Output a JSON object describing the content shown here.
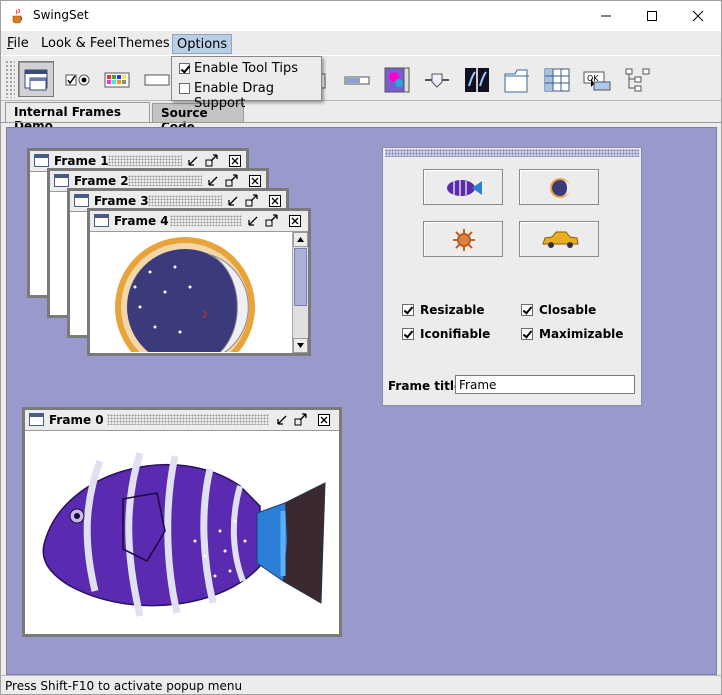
{
  "window": {
    "title": "SwingSet"
  },
  "menubar": {
    "items": [
      {
        "label": "File",
        "mnemonic": "F"
      },
      {
        "label": "Look & Feel",
        "mnemonic": "L"
      },
      {
        "label": "Themes",
        "mnemonic": "T"
      },
      {
        "label": "Options",
        "mnemonic": "O",
        "active": true
      }
    ]
  },
  "options_menu": {
    "items": [
      {
        "label": "Enable Tool Tips",
        "checked": true
      },
      {
        "label": "Enable Drag Support",
        "checked": false
      }
    ]
  },
  "toolbar": {
    "buttons": [
      {
        "icon": "internal-frame-icon",
        "selected": true
      },
      {
        "icon": "checkbox-radio-icon"
      },
      {
        "icon": "color-chooser-icon"
      },
      {
        "icon": "combobox-icon"
      },
      {
        "icon": "file-chooser-icon"
      },
      {
        "icon": "html-icon"
      },
      {
        "icon": "list-icon"
      },
      {
        "icon": "option-pane-icon"
      },
      {
        "icon": "progress-bar-icon"
      },
      {
        "icon": "scroll-pane-icon"
      },
      {
        "icon": "slider-icon"
      },
      {
        "icon": "split-pane-icon"
      },
      {
        "icon": "tabbed-pane-icon"
      },
      {
        "icon": "table-icon"
      },
      {
        "icon": "tooltip-icon"
      },
      {
        "icon": "tree-icon"
      }
    ]
  },
  "tabs": [
    {
      "label": "Internal Frames Demo",
      "selected": true
    },
    {
      "label": "Source Code",
      "selected": false
    }
  ],
  "frames": [
    {
      "title": "Frame 1"
    },
    {
      "title": "Frame 2"
    },
    {
      "title": "Frame 3"
    },
    {
      "title": "Frame 4",
      "image": "moon"
    },
    {
      "title": "Frame 0",
      "image": "fish"
    }
  ],
  "control_panel": {
    "image_buttons": [
      "fish-icon",
      "moon-icon",
      "sun-icon",
      "cab-icon"
    ],
    "checkboxes": [
      {
        "label": "Resizable",
        "checked": true
      },
      {
        "label": "Closable",
        "checked": true
      },
      {
        "label": "Iconifiable",
        "checked": true
      },
      {
        "label": "Maximizable",
        "checked": true
      }
    ],
    "frame_title_label": "Frame title:",
    "frame_title_value": "Frame"
  },
  "status_bar": {
    "text": "Press Shift-F10 to activate popup menu"
  },
  "colors": {
    "desktop": "#9999cc",
    "menu_highlight": "#b8cfe5",
    "fish_purple": "#5a2ab0",
    "fish_tail": "#2b7fd6"
  }
}
